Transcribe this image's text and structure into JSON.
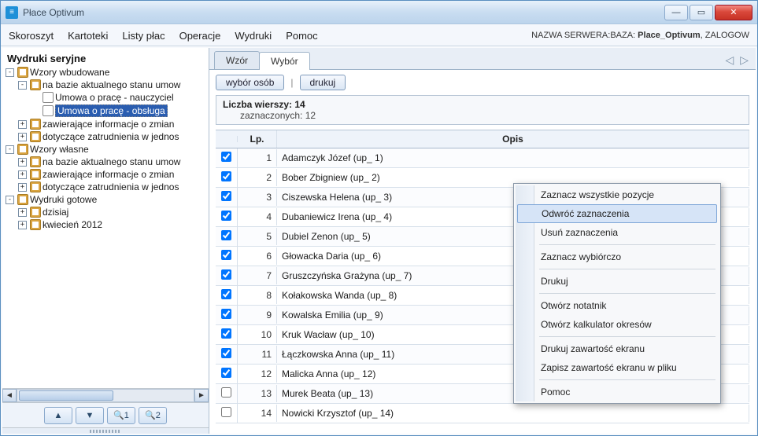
{
  "window": {
    "title": "Płace Optivum"
  },
  "win_controls": {
    "min": "—",
    "max": "▭",
    "close": "✕"
  },
  "menubar": {
    "items": [
      "Skoroszyt",
      "Kartoteki",
      "Listy płac",
      "Operacje",
      "Wydruki",
      "Pomoc"
    ],
    "status_prefix": "NAZWA SERWERA:BAZA: ",
    "status_bold": "Place_Optivum",
    "status_suffix": ", ZALOGOW"
  },
  "left": {
    "heading": "Wydruki seryjne",
    "tree": {
      "wzory_wbudowane": "Wzory wbudowane",
      "na_bazie_umow": "na bazie aktualnego stanu umow",
      "umowa_nauczyciel": "Umowa o pracę - nauczyciel",
      "umowa_obsluga": "Umowa o pracę - obsługa",
      "zaw_info_zmian_1": "zawierające informacje o zmian",
      "dot_zatr_jednos_1": "dotyczące zatrudnienia w jednos",
      "wzory_wlasne": "Wzory własne",
      "na_bazie_umow_2": "na bazie aktualnego stanu umow",
      "zaw_info_zmian_2": "zawierające informacje o zmian",
      "dot_zatr_jednos_2": "dotyczące zatrudnienia w jednos",
      "wydruki_gotowe": "Wydruki gotowe",
      "dzisiaj": "dzisiaj",
      "kwiecien": "kwiecień 2012"
    },
    "toolbar": {
      "up": "▲",
      "down": "▼",
      "search1": "🔍1",
      "search2": "🔍2"
    }
  },
  "tabs": {
    "wzor": "Wzór",
    "wybor": "Wybór"
  },
  "buttons": {
    "wybor_osob": "wybór osób",
    "drukuj": "drukuj"
  },
  "info": {
    "rows_label": "Liczba wierszy:",
    "rows_value": "14",
    "selected_label": "zaznaczonych:",
    "selected_value": "12"
  },
  "grid": {
    "col_chk": "",
    "col_lp": "Lp.",
    "col_opis": "Opis",
    "rows": [
      {
        "checked": true,
        "lp": 1,
        "opis": "Adamczyk Józef (up_ 1)"
      },
      {
        "checked": true,
        "lp": 2,
        "opis": "Bober Zbigniew (up_ 2)"
      },
      {
        "checked": true,
        "lp": 3,
        "opis": "Ciszewska Helena (up_ 3)"
      },
      {
        "checked": true,
        "lp": 4,
        "opis": "Dubaniewicz Irena (up_ 4)"
      },
      {
        "checked": true,
        "lp": 5,
        "opis": "Dubiel Zenon (up_ 5)"
      },
      {
        "checked": true,
        "lp": 6,
        "opis": "Głowacka Daria (up_ 6)"
      },
      {
        "checked": true,
        "lp": 7,
        "opis": "Gruszczyńska Grażyna (up_ 7)"
      },
      {
        "checked": true,
        "lp": 8,
        "opis": "Kołakowska Wanda (up_ 8)"
      },
      {
        "checked": true,
        "lp": 9,
        "opis": "Kowalska Emilia (up_ 9)"
      },
      {
        "checked": true,
        "lp": 10,
        "opis": "Kruk Wacław (up_ 10)"
      },
      {
        "checked": true,
        "lp": 11,
        "opis": "Łączkowska Anna (up_ 11)"
      },
      {
        "checked": true,
        "lp": 12,
        "opis": "Malicka Anna (up_ 12)"
      },
      {
        "checked": false,
        "lp": 13,
        "opis": "Murek Beata (up_ 13)"
      },
      {
        "checked": false,
        "lp": 14,
        "opis": "Nowicki Krzysztof (up_ 14)"
      }
    ]
  },
  "context_menu": {
    "items": [
      "Zaznacz wszystkie pozycje",
      "Odwróć zaznaczenia",
      "Usuń zaznaczenia",
      "Zaznacz wybiórczo",
      "Drukuj",
      "Otwórz notatnik",
      "Otwórz kalkulator okresów",
      "Drukuj zawartość ekranu",
      "Zapisz zawartość ekranu w pliku",
      "Pomoc"
    ],
    "highlight_index": 1,
    "separators_after": [
      2,
      3,
      4,
      6,
      8
    ]
  }
}
